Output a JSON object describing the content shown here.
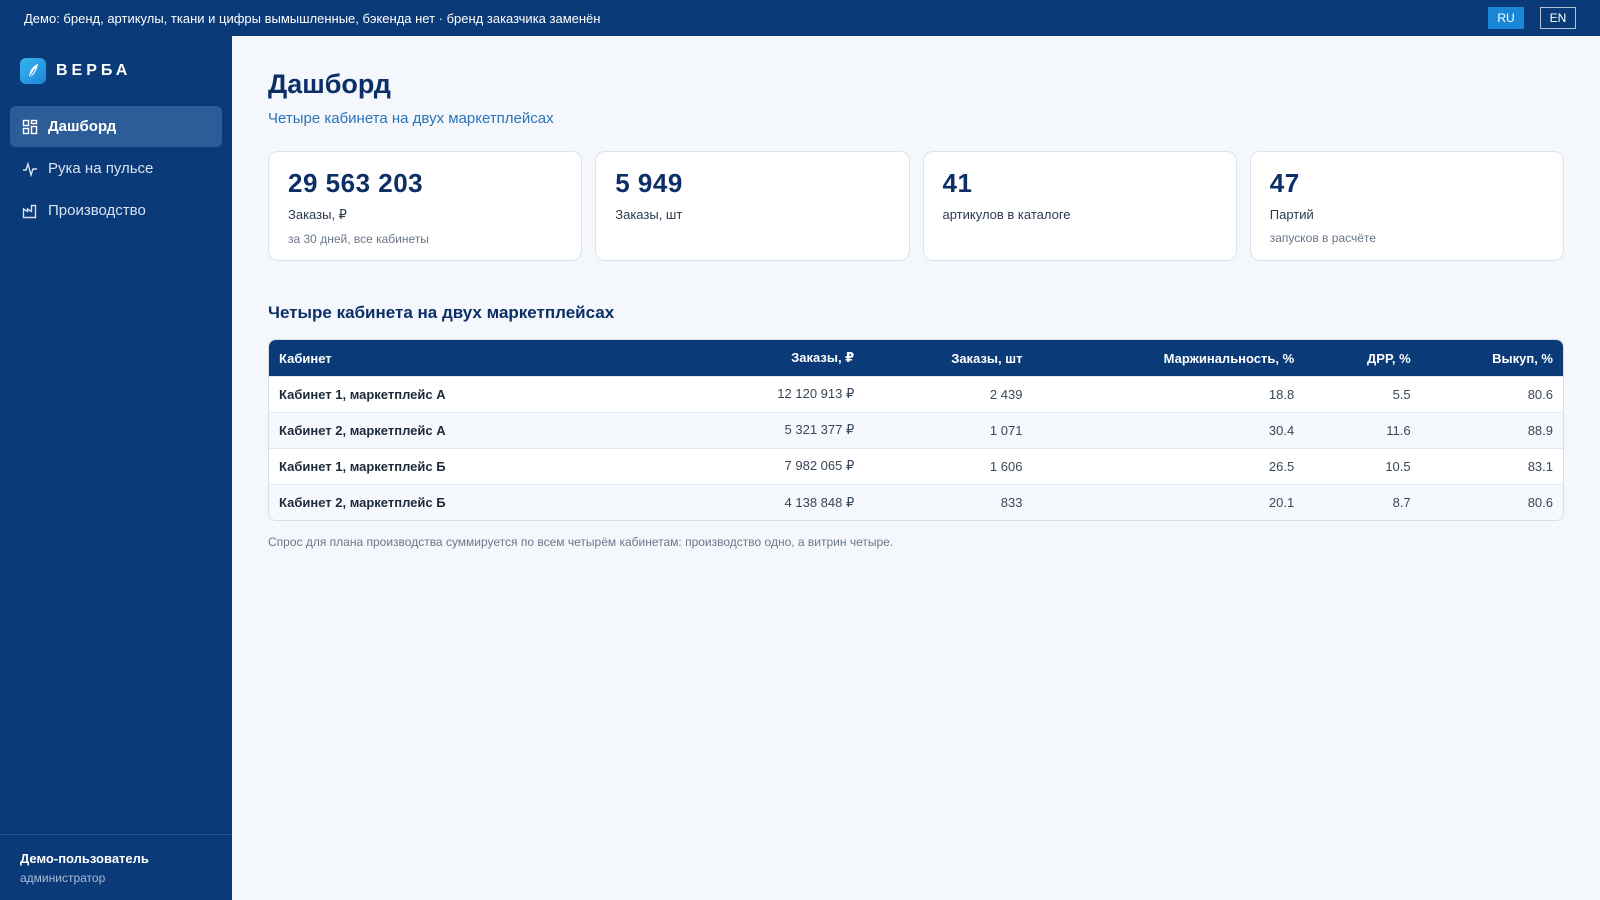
{
  "topbar": {
    "notice": "Демо: бренд, артикулы, ткани и цифры вымышленные, бэкенда нет · бренд заказчика заменён",
    "languages": [
      "RU",
      "EN"
    ],
    "active_language": "RU"
  },
  "sidebar": {
    "logo_text": "ВЕРБА",
    "items": [
      {
        "label": "Дашборд",
        "icon": "grid-icon",
        "active": true
      },
      {
        "label": "Рука на пульсе",
        "icon": "pulse-icon",
        "active": false
      },
      {
        "label": "Производство",
        "icon": "factory-icon",
        "active": false
      }
    ],
    "user": {
      "name": "Демо-пользователь",
      "role": "администратор"
    }
  },
  "main": {
    "title": "Дашборд",
    "subtitle": "Четыре кабинета на двух маркетплейсах",
    "kpis": [
      {
        "value": "29 563 203",
        "label": "Заказы, ₽",
        "hint": "за 30 дней, все кабинеты"
      },
      {
        "value": "5 949",
        "label": "Заказы, шт",
        "hint": ""
      },
      {
        "value": "41",
        "label": "артикулов в каталоге",
        "hint": ""
      },
      {
        "value": "47",
        "label": "Партий",
        "hint": "запусков в расчёте"
      }
    ],
    "table_title": "Четыре кабинета на двух маркетплейсах",
    "table": {
      "headers": [
        "Кабинет",
        "Заказы, ₽",
        "Заказы, шт",
        "Маржинальность, %",
        "ДРР, %",
        "Выкуп, %"
      ],
      "rows": [
        [
          "Кабинет 1, маркетплейс А",
          "12 120 913 ₽",
          "2 439",
          "18.8",
          "5.5",
          "80.6"
        ],
        [
          "Кабинет 2, маркетплейс А",
          "5 321 377 ₽",
          "1 071",
          "30.4",
          "11.6",
          "88.9"
        ],
        [
          "Кабинет 1, маркетплейс Б",
          "7 982 065 ₽",
          "1 606",
          "26.5",
          "10.5",
          "83.1"
        ],
        [
          "Кабинет 2, маркетплейс Б",
          "4 138 848 ₽",
          "833",
          "20.1",
          "8.7",
          "80.6"
        ]
      ]
    },
    "footnote": "Спрос для плана производства суммируется по всем четырём кабинетам: производство одно, а витрин четыре."
  },
  "colors": {
    "brand": "#0b3a78",
    "accent": "#1a86d8",
    "title": "#0b2f66",
    "subtitle": "#2b74b8"
  }
}
